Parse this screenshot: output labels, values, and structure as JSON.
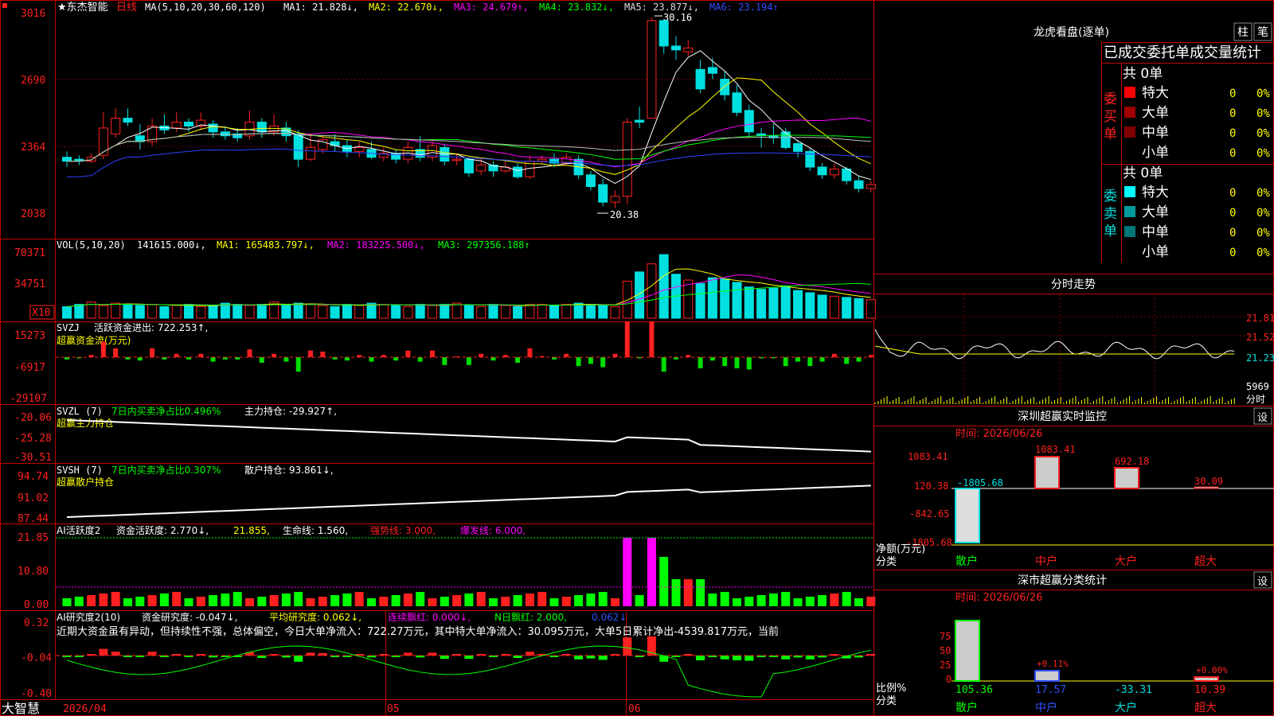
{
  "header": {
    "stock_name": "★东杰智能",
    "period": "日线",
    "ma_label": "MA(5,10,20,30,60,120)",
    "ma1": "MA1: 21.828↓,",
    "ma2": "MA2: 22.670↓,",
    "ma3": "MA3: 24.679↑,",
    "ma4": "MA4: 23.832↓,",
    "ma5": "MA5: 23.877↓,",
    "ma6": "MA6: 23.194↑"
  },
  "price_axis": [
    "3016",
    "2690",
    "2364",
    "2038"
  ],
  "price_annotations": {
    "high": "30.16",
    "low": "20.38"
  },
  "vol": {
    "label": "VOL(5,10,20)",
    "value": "141615.000↓,",
    "ma1": "MA1: 165483.797↓,",
    "ma2": "MA2: 183225.500↓,",
    "ma3": "MA3: 297356.188↑",
    "axis": [
      "70371",
      "34751"
    ],
    "unit": "X10"
  },
  "svzj": {
    "label": "SVZJ",
    "value": "活跃资金进出: 722.253↑,",
    "sub": "超赢资金流(万元)",
    "axis": [
      "15273",
      "-6917",
      "-29107"
    ]
  },
  "svzl": {
    "label": "SVZL (7)",
    "ratio": "7日内买卖净占比0.496%",
    "value": "主力持仓: -29.927↑,",
    "sub": "超赢主力持仓",
    "axis": [
      "-20.06",
      "-25.28",
      "-30.51"
    ]
  },
  "svsh": {
    "label": "SVSH (7)",
    "ratio": "7日内买卖净占比0.307%",
    "value": "散户持仓: 93.861↓,",
    "sub": "超赢散户持仓",
    "axis": [
      "94.74",
      "91.02",
      "87.44"
    ]
  },
  "ai1": {
    "label": "AI活跃度2",
    "v1": "资金活跃度: 2.770↓,",
    "v2": "21.855,",
    "v3": "生命线: 1.560,",
    "v4": "强势线: 3.000,",
    "v5": "爆发线: 6.000,",
    "axis": [
      "21.85",
      "10.80",
      "0.00"
    ]
  },
  "ai2": {
    "label": "AI研究度2(10)",
    "v1": "资金研究度: -0.047↓,",
    "v2": "平均研究度: 0.062↓,",
    "v3": "连续飘红: 0.000↓,",
    "v4": "N日飘红: 2.000,",
    "v5": "0.062↓",
    "comment": "近期大资金虽有异动，但持续性不强，总体偏空，今日大单净流入：722.27万元，其中特大单净流入：30.095万元，大单5日累计净出-4539.817万元，当前",
    "axis": [
      "0.32",
      "-0.04",
      "-0.40"
    ]
  },
  "bottom": {
    "brand": "大智慧",
    "date": "2026/04",
    "m5": "05",
    "m6": "06"
  },
  "right": {
    "lhb_title": "龙虎看盘(逐单)",
    "btn_zhu": "柱",
    "btn_bi": "笔",
    "stat_title": "已成交委托单成交量统计",
    "buy_label": "委买单",
    "sell_label": "委卖单",
    "buy_total": "共 0单",
    "sell_total": "共 0单",
    "buy_rows": [
      {
        "name": "特大",
        "count": "0",
        "pct": "0%"
      },
      {
        "name": "大单",
        "count": "0",
        "pct": "0%"
      },
      {
        "name": "中单",
        "count": "0",
        "pct": "0%"
      },
      {
        "name": "小单",
        "count": "0",
        "pct": "0%"
      }
    ],
    "sell_rows": [
      {
        "name": "特大",
        "count": "0",
        "pct": "0%"
      },
      {
        "name": "大单",
        "count": "0",
        "pct": "0%"
      },
      {
        "name": "中单",
        "count": "0",
        "pct": "0%"
      },
      {
        "name": "小单",
        "count": "0",
        "pct": "0%"
      }
    ],
    "fenshi_title": "分时走势",
    "fenshi_axis": [
      "21.81",
      "21.52",
      "21.23"
    ],
    "fenshi_vol": "5969",
    "fenshi_unit": "分时",
    "sz_monitor_title": "深圳超赢实时监控",
    "set_btn": "设",
    "time_label": "时间: 2026/06/26",
    "monitor_axis": [
      "1083.41",
      "120.38",
      "-842.65",
      "-1805.68"
    ],
    "monitor_values": [
      "-1805.68",
      "1083.41",
      "692.18",
      "30.09"
    ],
    "monitor_ylabel": "净额(万元)",
    "monitor_xlabel": "分类",
    "categories": [
      "散户",
      "中户",
      "大户",
      "超大"
    ],
    "class_title": "深市超赢分类统计",
    "class_time": "时间: 2026/06/26",
    "class_axis": [
      "75",
      "50",
      "25",
      "0"
    ],
    "class_pct_labels": [
      "+0.11%",
      "+0.00%"
    ],
    "class_values": [
      "105.36",
      "17.57",
      "-33.31",
      "10.39"
    ],
    "class_ylabel": "比例%",
    "class_xlabel": "分类"
  },
  "colors": {
    "up": "#ff2020",
    "down": "#00e0e0",
    "bg": "#000000",
    "grid": "#c00000",
    "ma1": "#ffffff",
    "ma2": "#ffff00",
    "ma3": "#ff00ff",
    "ma4": "#00ff00",
    "ma5": "#bbbbbb",
    "ma6": "#3040ff"
  },
  "chart_data": [
    {
      "type": "candlestick",
      "title": "东杰智能 日线",
      "ylim": [
        20.0,
        30.5
      ],
      "candles": [
        [
          23.0,
          22.8,
          23.3,
          22.5
        ],
        [
          22.9,
          22.8,
          23.1,
          22.6
        ],
        [
          22.8,
          23.0,
          23.2,
          22.7
        ],
        [
          23.1,
          24.5,
          25.3,
          22.9
        ],
        [
          24.2,
          25.0,
          25.5,
          24.0
        ],
        [
          25.0,
          24.8,
          25.5,
          24.6
        ],
        [
          24.1,
          23.8,
          24.7,
          23.4
        ],
        [
          23.8,
          24.6,
          25.0,
          23.6
        ],
        [
          24.6,
          24.4,
          25.2,
          24.2
        ],
        [
          24.5,
          24.8,
          25.3,
          24.3
        ],
        [
          24.8,
          24.6,
          25.0,
          24.3
        ],
        [
          24.6,
          24.9,
          25.3,
          24.4
        ],
        [
          24.7,
          24.3,
          24.9,
          24.0
        ],
        [
          24.3,
          24.1,
          24.6,
          23.9
        ],
        [
          24.2,
          24.0,
          24.5,
          23.8
        ],
        [
          24.1,
          24.8,
          25.4,
          23.9
        ],
        [
          24.8,
          24.3,
          25.0,
          24.0
        ],
        [
          24.3,
          24.6,
          25.2,
          24.1
        ],
        [
          24.5,
          24.1,
          24.8,
          23.8
        ],
        [
          24.2,
          22.9,
          24.4,
          22.5
        ],
        [
          22.9,
          23.5,
          24.2,
          22.8
        ],
        [
          23.4,
          23.9,
          24.1,
          23.2
        ],
        [
          23.8,
          23.6,
          24.2,
          23.3
        ],
        [
          23.6,
          23.3,
          23.9,
          23.0
        ],
        [
          23.3,
          23.5,
          23.8,
          23.0
        ],
        [
          23.4,
          23.0,
          23.8,
          22.9
        ],
        [
          23.0,
          23.2,
          23.5,
          22.8
        ],
        [
          23.2,
          22.9,
          23.4,
          22.7
        ],
        [
          22.9,
          23.5,
          23.8,
          22.7
        ],
        [
          23.4,
          23.0,
          24.1,
          22.8
        ],
        [
          23.0,
          23.6,
          23.9,
          22.8
        ],
        [
          23.5,
          22.8,
          23.7,
          22.6
        ],
        [
          22.9,
          22.9,
          23.2,
          22.6
        ],
        [
          22.9,
          22.2,
          23.0,
          22.0
        ],
        [
          22.3,
          22.6,
          22.9,
          22.1
        ],
        [
          22.6,
          22.3,
          22.8,
          22.0
        ],
        [
          22.3,
          22.5,
          22.8,
          22.2
        ],
        [
          22.5,
          22.0,
          22.7,
          21.9
        ],
        [
          22.0,
          22.8,
          23.1,
          21.9
        ],
        [
          22.8,
          22.9,
          23.1,
          22.7
        ],
        [
          22.9,
          22.7,
          23.2,
          22.5
        ],
        [
          22.7,
          23.0,
          23.2,
          22.6
        ],
        [
          22.9,
          22.1,
          23.1,
          21.9
        ],
        [
          22.1,
          21.5,
          22.3,
          21.3
        ],
        [
          21.6,
          20.7,
          21.9,
          20.5
        ],
        [
          20.7,
          21.0,
          21.3,
          20.4
        ],
        [
          21.0,
          24.8,
          25.0,
          20.6
        ],
        [
          24.9,
          24.8,
          25.6,
          24.5
        ],
        [
          25.0,
          30.0,
          30.16,
          25.0
        ],
        [
          30.0,
          28.7,
          30.1,
          28.3
        ],
        [
          28.7,
          28.5,
          29.2,
          28.0
        ],
        [
          28.4,
          28.6,
          29.0,
          28.2
        ],
        [
          27.5,
          26.5,
          28.0,
          26.3
        ],
        [
          27.6,
          27.3,
          28.1,
          27.0
        ],
        [
          27.0,
          26.2,
          27.4,
          25.9
        ],
        [
          26.3,
          25.3,
          26.7,
          25.1
        ],
        [
          25.4,
          24.3,
          25.7,
          24.0
        ],
        [
          24.2,
          24.1,
          24.5,
          23.5
        ],
        [
          24.1,
          24.0,
          24.7,
          23.7
        ],
        [
          24.3,
          23.5,
          24.5,
          23.4
        ],
        [
          23.7,
          23.3,
          23.9,
          23.0
        ],
        [
          23.3,
          22.5,
          23.5,
          22.3
        ],
        [
          22.5,
          22.1,
          22.7,
          21.9
        ],
        [
          22.1,
          22.4,
          22.7,
          21.9
        ],
        [
          22.4,
          21.8,
          22.5,
          21.6
        ],
        [
          21.8,
          21.4,
          22.0,
          21.2
        ],
        [
          21.4,
          21.6,
          21.8,
          21.2
        ]
      ],
      "ma_values": {
        "MA1": 21.828,
        "MA2": 22.67,
        "MA3": 24.679,
        "MA4": 23.832,
        "MA5": 23.877,
        "MA6": 23.194
      }
    },
    {
      "type": "bar",
      "title": "VOL(5,10,20)",
      "values": [
        10,
        12,
        14,
        11,
        13,
        12,
        11,
        12,
        10,
        11,
        12,
        10,
        11,
        13,
        12,
        11,
        12,
        14,
        11,
        13,
        12,
        11,
        10,
        12,
        11,
        13,
        12,
        11,
        10,
        12,
        11,
        12,
        13,
        11,
        10,
        12,
        11,
        10,
        12,
        12,
        11,
        12,
        13,
        12,
        11,
        10,
        32,
        40,
        47,
        55,
        38,
        33,
        30,
        35,
        34,
        31,
        27,
        25,
        26,
        28,
        24,
        22,
        20,
        19,
        18,
        17,
        16
      ]
    }
  ]
}
